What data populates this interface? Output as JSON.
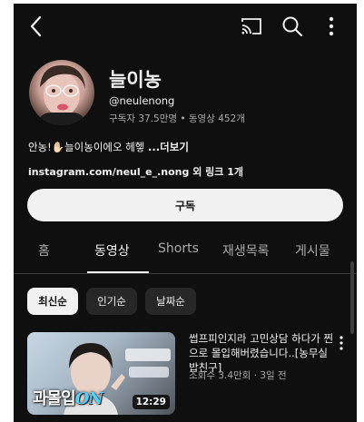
{
  "topbar": {
    "back_icon": "chevron-left-icon",
    "cast_icon": "cast-icon",
    "search_icon": "search-icon",
    "more_icon": "more-vertical-icon"
  },
  "channel": {
    "name": "늘이농",
    "handle": "@neulenong",
    "stats": "구독자 37.5만명 • 동영상 452개",
    "description": "안농!✋🏻늘이농이에오 헤헿 ",
    "description_more": "...더보기",
    "link_text": "instagram.com/neul_e_.nong 외 링크 1개",
    "subscribe_label": "구독"
  },
  "tabs": [
    {
      "label": "홈",
      "active": false
    },
    {
      "label": "동영상",
      "active": true
    },
    {
      "label": "Shorts",
      "active": false
    },
    {
      "label": "재생목록",
      "active": false
    },
    {
      "label": "게시물",
      "active": false
    }
  ],
  "filters": [
    {
      "label": "최신순",
      "active": true
    },
    {
      "label": "인기순",
      "active": false
    },
    {
      "label": "날짜순",
      "active": false
    }
  ],
  "video": {
    "thumbnail_caption": "과몰입",
    "thumbnail_caption_on": "ON",
    "duration": "12:29",
    "title": "썹프피인지라 고민상담 하다가 찐으로 몰입해버렸습니다..[농무실 밥친구]",
    "meta": "조회수 3.4만회 · 3일 전"
  },
  "colors": {
    "background": "#0f0f0f",
    "text_primary": "#f1f1f1",
    "text_secondary": "#aaaaaa",
    "chip_bg": "#272727"
  }
}
